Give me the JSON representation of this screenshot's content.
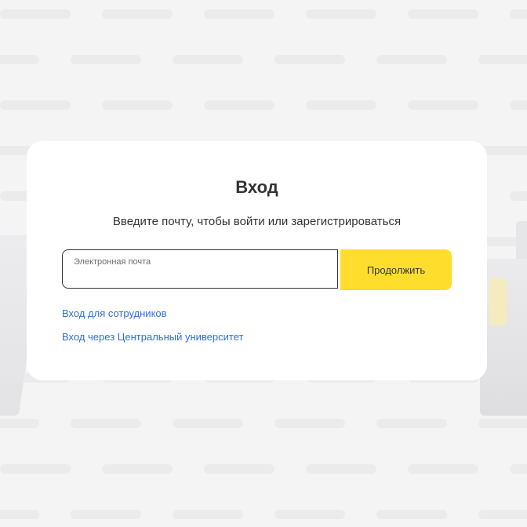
{
  "login": {
    "title": "Вход",
    "subtitle": "Введите почту, чтобы войти или зарегистрироваться",
    "email_label": "Электронная почта",
    "email_value": "",
    "continue_label": "Продолжить",
    "links": [
      "Вход для сотрудников",
      "Вход через Центральный университет"
    ]
  },
  "colors": {
    "accent": "#ffdd2d",
    "link": "#2f6ed8",
    "text": "#333333",
    "background": "#f4f4f5",
    "card": "#ffffff"
  }
}
